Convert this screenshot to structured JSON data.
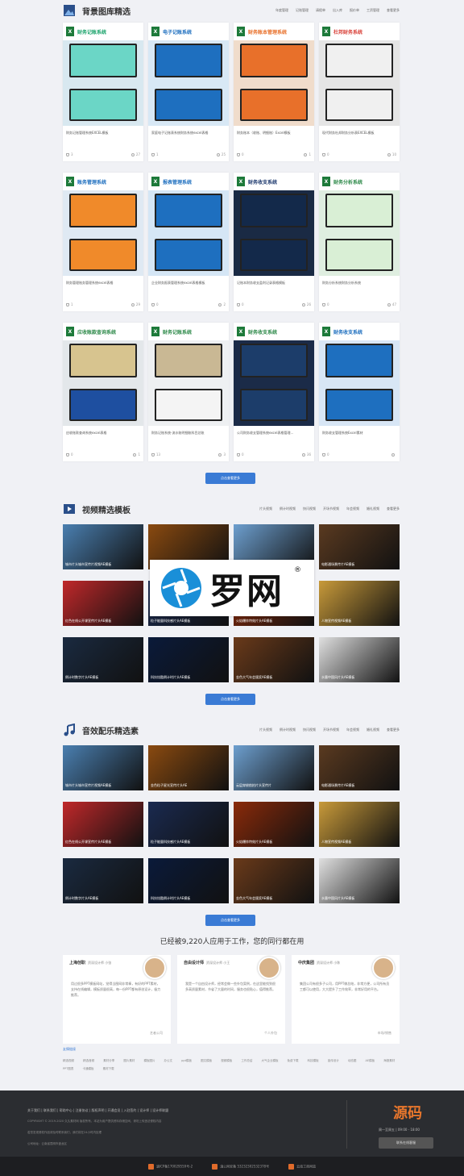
{
  "section1": {
    "title": "背景图库精选",
    "nav": [
      "年度管理",
      "记账管理",
      "请假单",
      "出入库",
      "报价单",
      "工资管理",
      "查看更多"
    ],
    "cards": [
      {
        "thumb_title": "财务记账系统",
        "desc": "财务记账管理系统EXCEL模板",
        "downloads": "3",
        "likes": "27",
        "accent": "#1aa36b",
        "bg": "#d8e8f0",
        "p1": "#6bd6c6",
        "p2": "#6bd6c6"
      },
      {
        "thumb_title": "电子记账系统",
        "desc": "家庭电子记账表系统财务系统excel表格",
        "downloads": "1",
        "likes": "25",
        "accent": "#1e6fbf",
        "bg": "#d8e8f5",
        "p1": "#1e6fbf",
        "p2": "#1e6fbf"
      },
      {
        "thumb_title": "财务账本管理系统",
        "desc": "财务账本（收账、明细账）Excel模板",
        "downloads": "0",
        "likes": "1",
        "accent": "#e8702a",
        "bg": "#f0dccb",
        "p1": "#e8702a",
        "p2": "#e8702a"
      },
      {
        "thumb_title": "杜邦财务系统",
        "desc": "现代财务杜邦财务分析表EXCEL模板",
        "downloads": "0",
        "likes": "10",
        "accent": "#d9433b",
        "bg": "#e5e5e5",
        "p1": "#f0f0f0",
        "p2": "#f0f0f0"
      },
      {
        "thumb_title": "账务管理系统",
        "desc": "财务管理账务管理系统excel表格",
        "downloads": "1",
        "likes": "29",
        "accent": "#1e6fbf",
        "bg": "#dfe9f3",
        "p1": "#f08a2a",
        "p2": "#f08a2a"
      },
      {
        "thumb_title": "报表管理系统",
        "desc": "企业财务报表管理系统excel表格模板",
        "downloads": "0",
        "likes": "2",
        "accent": "#1e6fbf",
        "bg": "#d5e6f5",
        "p1": "#1e6fbf",
        "p2": "#1e6fbf"
      },
      {
        "thumb_title": "财务收支系统",
        "desc": "记账本财务收支盈利记录表格模板",
        "downloads": "0",
        "likes": "26",
        "accent": "#1e3a6f",
        "bg": "#1a2a44",
        "p1": "#13294a",
        "p2": "#13294a"
      },
      {
        "thumb_title": "财务分析系统",
        "desc": "财务分析系统财务分析系统",
        "downloads": "0",
        "likes": "47",
        "accent": "#2e8a4a",
        "bg": "#dfeee0",
        "p1": "#d9efd5",
        "p2": "#d9efd5"
      },
      {
        "thumb_title": "应收账款查询系统",
        "desc": "应收账款查询系统excel表格",
        "downloads": "0",
        "likes": "1",
        "accent": "#2e8a4a",
        "bg": "#e3e7ea",
        "p1": "#d7c48f",
        "p2": "#1e4fa0"
      },
      {
        "thumb_title": "财务记账系统",
        "desc": "财务记账系统-流水账明细账科目总账",
        "downloads": "13",
        "likes": "3",
        "accent": "#2e8a4a",
        "bg": "#eef0f2",
        "p1": "#c9b894",
        "p2": "#f4f4f4"
      },
      {
        "thumb_title": "财务收支系统",
        "desc": "公司财务收支管理系统excel表格管理...",
        "downloads": "0",
        "likes": "36",
        "accent": "#2e8a4a",
        "bg": "#1b2b48",
        "p1": "#1c3d6a",
        "p2": "#1c3d6a"
      },
      {
        "thumb_title": "财务收支系统",
        "desc": "财务收支管理系统Excel素材",
        "downloads": "0",
        "likes": "",
        "accent": "#1e6fbf",
        "bg": "#d8e6f5",
        "p1": "#1e6fbf",
        "p2": "#1e6fbf"
      }
    ],
    "more": "点击查看更多"
  },
  "section2": {
    "title": "视频精选模板",
    "nav": [
      "片头视频",
      "倒计时视频",
      "快闪视频",
      "开场节视频",
      "年会视频",
      "婚礼视频",
      "查看更多"
    ],
    "videos": [
      {
        "cap": "城市片头城市宣传片视频AE模板",
        "color": "#4a7fb0"
      },
      {
        "cap": "金色粒子星光宣传片头AE",
        "color": "#8a4a10"
      },
      {
        "cap": "云层穿梭航拍片头宣传片",
        "color": "#6d9fcf"
      },
      {
        "cap": "电影通场景传片AE模板",
        "color": "#5a3a20"
      },
      {
        "cap": "红色在线公开课宣传片头AE模板",
        "color": "#c0282a"
      },
      {
        "cap": "粒子能量科技感片头AE模板",
        "color": "#1a2a50"
      },
      {
        "cap": "火焰爆炸特效片头AE模板",
        "color": "#8a2a0a"
      },
      {
        "cap": "人物宣传视频AE模板",
        "color": "#c89a3a"
      },
      {
        "cap": "倒计时数字片头AE模板",
        "color": "#1a2a40"
      },
      {
        "cap": "科技炫酷倒计时片头AE模板",
        "color": "#0a1a3a"
      },
      {
        "cap": "金色大气年会颁奖AE模板",
        "color": "#6a3a1a"
      },
      {
        "cap": "水墨中国风片头AE模板",
        "color": "#e0e0e0"
      }
    ],
    "more": "点击查看更多"
  },
  "section3": {
    "title": "音效配乐精选素",
    "nav": [
      "片头视频",
      "倒计时视频",
      "快闪视频",
      "开场节视频",
      "年会视频",
      "婚礼视频",
      "查看更多"
    ],
    "videos": [
      {
        "cap": "城市片头城市宣传片视频AE模板",
        "color": "#4a7fb0"
      },
      {
        "cap": "金色粒子星光宣传片头AE",
        "color": "#8a4a10"
      },
      {
        "cap": "云层穿梭航拍片头宣传片",
        "color": "#6d9fcf"
      },
      {
        "cap": "电影通场景传片AE模板",
        "color": "#5a3a20"
      },
      {
        "cap": "红色在线公开课宣传片头AE模板",
        "color": "#c0282a"
      },
      {
        "cap": "粒子能量科技感片头AE模板",
        "color": "#1a2a50"
      },
      {
        "cap": "火焰爆炸特效片头AE模板",
        "color": "#8a2a0a"
      },
      {
        "cap": "人物宣传视频AE模板",
        "color": "#c89a3a"
      },
      {
        "cap": "倒计时数字片头AE模板",
        "color": "#1a2a40"
      },
      {
        "cap": "科技炫酷倒计时片头AE模板",
        "color": "#0a1a3a"
      },
      {
        "cap": "金色大气年会颁奖AE模板",
        "color": "#6a3a1a"
      },
      {
        "cap": "水墨中国风片头AE模板",
        "color": "#e0e0e0"
      }
    ],
    "more": "点击查看更多"
  },
  "watermark": {
    "text": "罗网",
    "reg": "®"
  },
  "testimonials": {
    "title": "已经被9,220人应用于工作，您的同行都在用",
    "items": [
      {
        "name": "上海创职",
        "role": "资深设计师 小张",
        "quote": "用过很多PPT模板网站，觉得当图网非常棒，有好的PPT素材，支持在线编辑，模板质量很高，每一份PPT都有原创设计，极力推荐。",
        "company": "艺者公司"
      },
      {
        "name": "自由设计师",
        "role": "资深设计师 小王",
        "quote": "我是一个自由设计师，经常会做一些外包案例，在这里能找到很多高质量素材，节省了大量的时间，服务也很贴心，值得推荐。",
        "company": "个人外包"
      },
      {
        "name": "中庆集团",
        "role": "资深设计师 小陈",
        "quote": "集团公司有很多子公司，用PPT做总结，非常方便，公司所有员工都可以使用，大大提升了工作效率，非常好用的平台。",
        "company": "市场/销售"
      }
    ]
  },
  "links": {
    "title": "友情链接",
    "items": "精选视频 精选音频 素材分享 图片素材 模板图片 办公文 ppt模板 图文模板 视频模板 工作总结 大气企业模板 免费下载 科技模板 宣传设计 动态图 AE模板 海报素材 PPT图表 卡通模板 素材下载"
  },
  "footer": {
    "nav": "关于我们 | 联系我们 | 帮助中心 | 注册协议 | 版权声明 | 开通会员 | 入驻签约 | 设计师 | 设计师联盟",
    "copyright": "COPYRIGHT © 2019-2020 久久素材网 版权所有，本站为用户提供资料存储空间，请勿上传违法侵权内容",
    "notice": "若您发现侵权作品请及时联系我们，我们将在24小时内处理",
    "address": "公司地址：云南省昆明市盘龙区",
    "logo": "源码",
    "hours": "周一至周五 | 09:00 - 18:00",
    "service": "联系在线客服",
    "icp1": "滇ICP备170029559号-2",
    "icp2": "滇公网安备 53232302532378号",
    "icp3": "云南工商网监"
  },
  "colors": {
    "accent": "#3a7bd5",
    "footer": "#2b2d31"
  }
}
